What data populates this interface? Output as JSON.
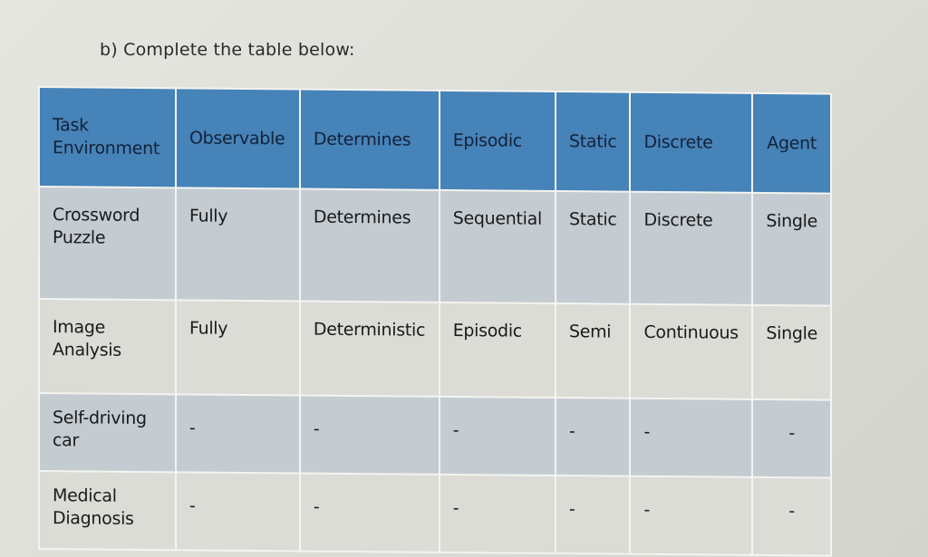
{
  "instruction": "b) Complete the table below:",
  "table": {
    "headers": [
      "Task\nEnvironment",
      "Observable",
      "Determines",
      "Episodic",
      "Static",
      "Discrete",
      "Agent"
    ],
    "rows": [
      {
        "task": "Crossword\nPuzzle",
        "cells": [
          "Fully",
          "Determines",
          "Sequential",
          "Static",
          "Discrete",
          "Single"
        ]
      },
      {
        "task": "Image\nAnalysis",
        "cells": [
          "Fully",
          "Deterministic",
          "Episodic",
          "Semi",
          "Continuous",
          "Single"
        ]
      },
      {
        "task": "Self-driving\ncar",
        "cells": [
          "-",
          "-",
          "-",
          "-",
          "-",
          "-"
        ]
      },
      {
        "task": "Medical\nDiagnosis",
        "cells": [
          "-",
          "-",
          "-",
          "-",
          "-",
          "-"
        ]
      }
    ]
  },
  "colors": {
    "header_bg": "#4683b8",
    "header_text": "#14223a",
    "row_dark": "#c4ccd2",
    "row_light": "#dcdcd6"
  }
}
